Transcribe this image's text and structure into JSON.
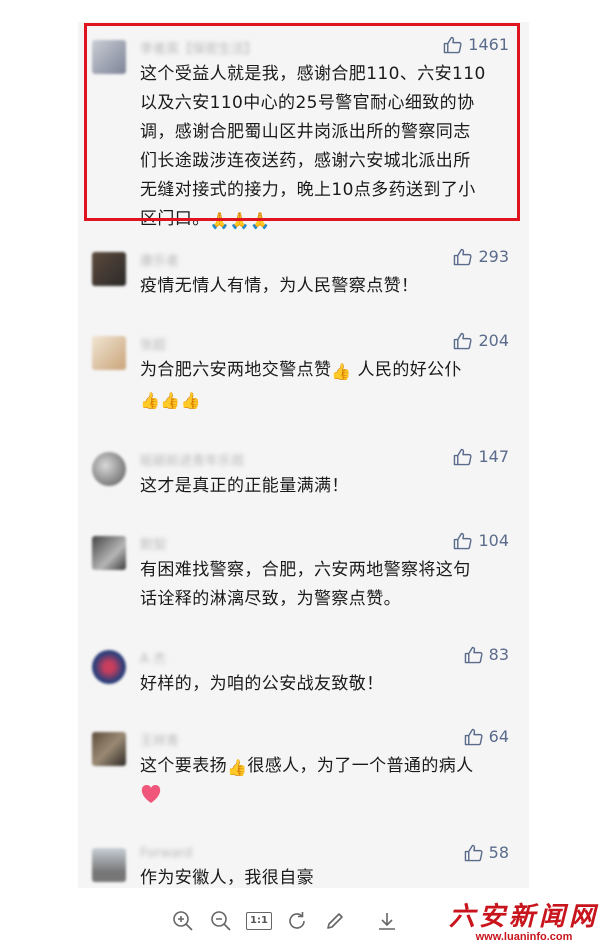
{
  "comments": [
    {
      "username": "李者英【保密生活】",
      "likes": "1461",
      "text_lines": [
        "这个受益人就是我，感谢合肥110、六安110",
        "以及六安110中心的25号警官耐心细致的协",
        "调，感谢合肥蜀山区井岗派出所的警察同志",
        "们长途跋涉连夜送药，感谢六安城北派出所",
        "无缝对接式的接力，晚上10点多药送到了小",
        "区门口。"
      ],
      "emoji_suffix": "🙏🙏🙏",
      "highlighted": true
    },
    {
      "username": "康乐者",
      "likes": "293",
      "text_lines": [
        "疫情无情人有情，为人民警察点赞！"
      ]
    },
    {
      "username": "张超",
      "likes": "204",
      "text_lines": [
        "为合肥六安两地交警点赞",
        "人民的好公仆"
      ],
      "emoji_mid": "👍"
    },
    {
      "username": "砥砺前进青年乐观",
      "likes": "147",
      "text_lines": [
        "这才是真正的正能量满满！"
      ]
    },
    {
      "username": "默契",
      "likes": "104",
      "text_lines": [
        "有困难找警察，合肥，六安两地警察将这句",
        "话诠释的淋漓尽致，为警察点赞。"
      ]
    },
    {
      "username": "A 杰",
      "likes": "83",
      "text_lines": [
        "好样的，为咱的公安战友致敬！"
      ]
    },
    {
      "username": "王祥青",
      "likes": "64",
      "text_lines": [
        "这个要表扬",
        "很感人，为了一个普通的病人"
      ]
    },
    {
      "username": "Forward",
      "likes": "58",
      "text_lines": [
        "作为安徽人，我很自豪"
      ]
    }
  ],
  "toolbar": {
    "icons": [
      "zoom-in-icon",
      "zoom-out-icon",
      "actual-size-icon",
      "rotate-icon",
      "edit-icon",
      "download-icon"
    ],
    "actual_size_label": "1:1"
  },
  "watermark": {
    "title": "六安新闻网",
    "url": "www.luaninfo.com"
  },
  "colors": {
    "highlight_border": "#e0141f",
    "like_color": "#5b6b8c",
    "watermark": "#c8141c",
    "panel_bg": "#f5f5f5"
  }
}
